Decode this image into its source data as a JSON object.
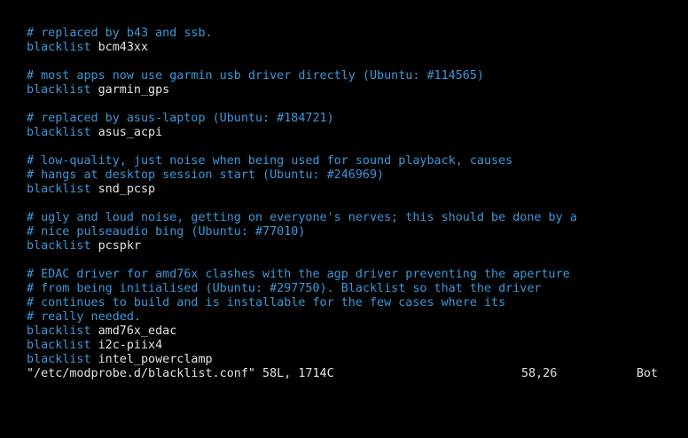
{
  "buffer": {
    "lines": [
      {
        "type": "comment",
        "text": "# replaced by b43 and ssb."
      },
      {
        "type": "cmd",
        "keyword": "blacklist",
        "arg": "bcm43xx"
      },
      {
        "type": "blank",
        "text": ""
      },
      {
        "type": "comment",
        "text": "# most apps now use garmin usb driver directly (Ubuntu: #114565)"
      },
      {
        "type": "cmd",
        "keyword": "blacklist",
        "arg": "garmin_gps"
      },
      {
        "type": "blank",
        "text": ""
      },
      {
        "type": "comment",
        "text": "# replaced by asus-laptop (Ubuntu: #184721)"
      },
      {
        "type": "cmd",
        "keyword": "blacklist",
        "arg": "asus_acpi"
      },
      {
        "type": "blank",
        "text": ""
      },
      {
        "type": "comment",
        "text": "# low-quality, just noise when being used for sound playback, causes"
      },
      {
        "type": "comment",
        "text": "# hangs at desktop session start (Ubuntu: #246969)"
      },
      {
        "type": "cmd",
        "keyword": "blacklist",
        "arg": "snd_pcsp"
      },
      {
        "type": "blank",
        "text": ""
      },
      {
        "type": "comment",
        "text": "# ugly and loud noise, getting on everyone's nerves; this should be done by a"
      },
      {
        "type": "comment",
        "text": "# nice pulseaudio bing (Ubuntu: #77010)"
      },
      {
        "type": "cmd",
        "keyword": "blacklist",
        "arg": "pcspkr"
      },
      {
        "type": "blank",
        "text": ""
      },
      {
        "type": "comment",
        "text": "# EDAC driver for amd76x clashes with the agp driver preventing the aperture"
      },
      {
        "type": "comment",
        "text": "# from being initialised (Ubuntu: #297750). Blacklist so that the driver"
      },
      {
        "type": "comment",
        "text": "# continues to build and is installable for the few cases where its"
      },
      {
        "type": "comment",
        "text": "# really needed."
      },
      {
        "type": "cmd",
        "keyword": "blacklist",
        "arg": "amd76x_edac"
      },
      {
        "type": "cmd",
        "keyword": "blacklist",
        "arg": "i2c-piix4"
      },
      {
        "type": "cmd",
        "keyword": "blacklist",
        "arg": "intel_powerclamp"
      }
    ]
  },
  "statusline": {
    "file": "\"/etc/modprobe.d/blacklist.conf\" 58L, 1714C",
    "position": "58,26",
    "scroll": "Bot"
  },
  "colors": {
    "background": "#000000",
    "comment": "#3d98d8",
    "keyword": "#3d98d8",
    "text": "#e2e2e2"
  }
}
